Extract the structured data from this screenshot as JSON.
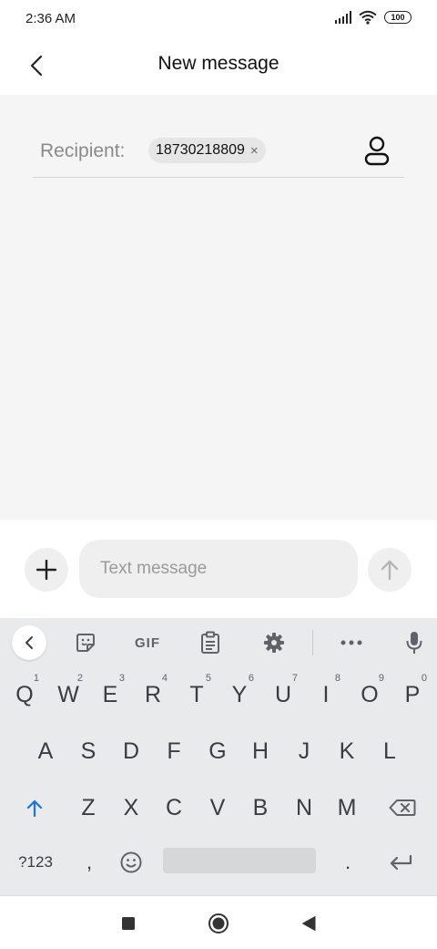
{
  "status_bar": {
    "time": "2:36 AM",
    "battery": "100"
  },
  "header": {
    "title": "New message"
  },
  "recipient": {
    "label": "Recipient:",
    "chip": "18730218809",
    "chip_close": "×"
  },
  "compose": {
    "placeholder": "Text message",
    "value": ""
  },
  "keyboard": {
    "toolbar": {
      "gif": "GIF"
    },
    "row1": [
      {
        "key": "Q",
        "hint": "1"
      },
      {
        "key": "W",
        "hint": "2"
      },
      {
        "key": "E",
        "hint": "3"
      },
      {
        "key": "R",
        "hint": "4"
      },
      {
        "key": "T",
        "hint": "5"
      },
      {
        "key": "Y",
        "hint": "6"
      },
      {
        "key": "U",
        "hint": "7"
      },
      {
        "key": "I",
        "hint": "8"
      },
      {
        "key": "O",
        "hint": "9"
      },
      {
        "key": "P",
        "hint": "0"
      }
    ],
    "row2": [
      "A",
      "S",
      "D",
      "F",
      "G",
      "H",
      "J",
      "K",
      "L"
    ],
    "row3": [
      "Z",
      "X",
      "C",
      "V",
      "B",
      "N",
      "M"
    ],
    "row4": {
      "symbols": "?123",
      "comma": ",",
      "period": "."
    },
    "accent_color": "#1a73e8"
  }
}
